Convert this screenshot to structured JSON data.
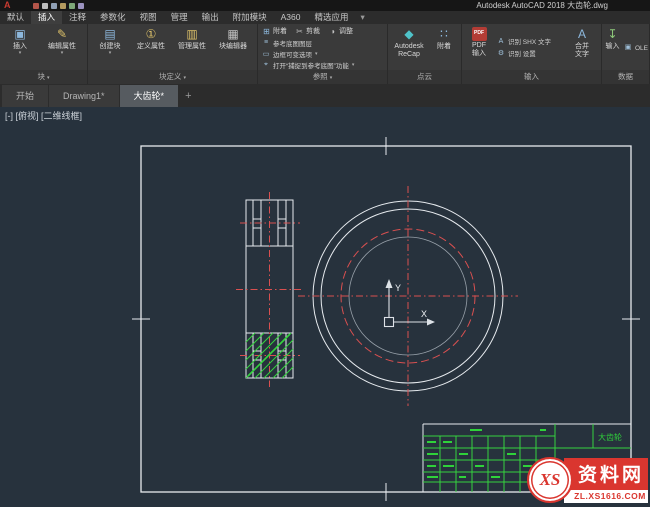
{
  "colors": {
    "canvas-bg": "#27323d",
    "line-white": "#e7ebef",
    "line-red": "#d95050",
    "line-green": "#35d33e",
    "line-dim": "#98a1aa",
    "tb-green": "#2fd23a",
    "wm-red": "#da362f"
  },
  "titlebar": {
    "logo": "A",
    "title": "Autodesk AutoCAD 2018   大齿轮.dwg"
  },
  "icons": {
    "dropdown": "▾",
    "insert_block": "▣",
    "edit_attribute": "✎",
    "create_block": "▤",
    "define_attributes": "①",
    "manage_attributes": "▥",
    "block_editor": "▦",
    "attach": "⊞",
    "clip": "✂",
    "adjust": "◑",
    "underlay_layers": "≡",
    "frames": "▭",
    "snap": "⌖",
    "recap": "◆",
    "pc_attach": "∷",
    "pdf_badge": "PDF",
    "shx": "A",
    "settings": "⚙",
    "combine": "A",
    "data_import": "↧",
    "ole": "▣",
    "plus": "+"
  },
  "ribbon": {
    "tabs": [
      {
        "label": "默认"
      },
      {
        "label": "插入"
      },
      {
        "label": "注释"
      },
      {
        "label": "参数化"
      },
      {
        "label": "视图"
      },
      {
        "label": "管理"
      },
      {
        "label": "输出"
      },
      {
        "label": "附加模块"
      },
      {
        "label": "A360"
      },
      {
        "label": "精选应用"
      }
    ],
    "block_panel": {
      "label": "块",
      "insert": "插入",
      "edit_attr": "编辑属性"
    },
    "blockdef_panel": {
      "label": "块定义",
      "create": "创建块",
      "def_attr": "定义属性",
      "manage_attr": "管理属性",
      "block_editor": "块编辑器"
    },
    "ref_panel": {
      "label": "参照",
      "attach": "附着",
      "clip": "剪裁",
      "adjust": "调整",
      "underlay_layers": "参考底图图层",
      "frames": "边框可变选项",
      "snap": "打开“捕捉到参考底图”功能"
    },
    "pointcloud_panel": {
      "label": "点云",
      "recap": "Autodesk\nReCap",
      "attach": "附着"
    },
    "import_panel": {
      "label": "输入",
      "pdf": "PDF\n输入",
      "shx": "识别 SHX 文字",
      "settings": "识别 设置",
      "combine": "合并\n文字"
    },
    "data_panel": {
      "label": "数据",
      "import": "输入",
      "ole": "OLE 对象"
    }
  },
  "doc_tabs": [
    {
      "label": "开始"
    },
    {
      "label": "Drawing1*"
    },
    {
      "label": "大齿轮*"
    }
  ],
  "viewport": {
    "controls": "[-]",
    "view": "[俯视]",
    "visual_style": "[二维线框]"
  },
  "canvas": {
    "ucs": {
      "x_label": "X",
      "y_label": "Y"
    },
    "title_block": {
      "part_name": "大齿轮"
    }
  },
  "watermark": {
    "logo": "XS",
    "name": "资料网",
    "url": "ZL.XS1616.COM"
  }
}
